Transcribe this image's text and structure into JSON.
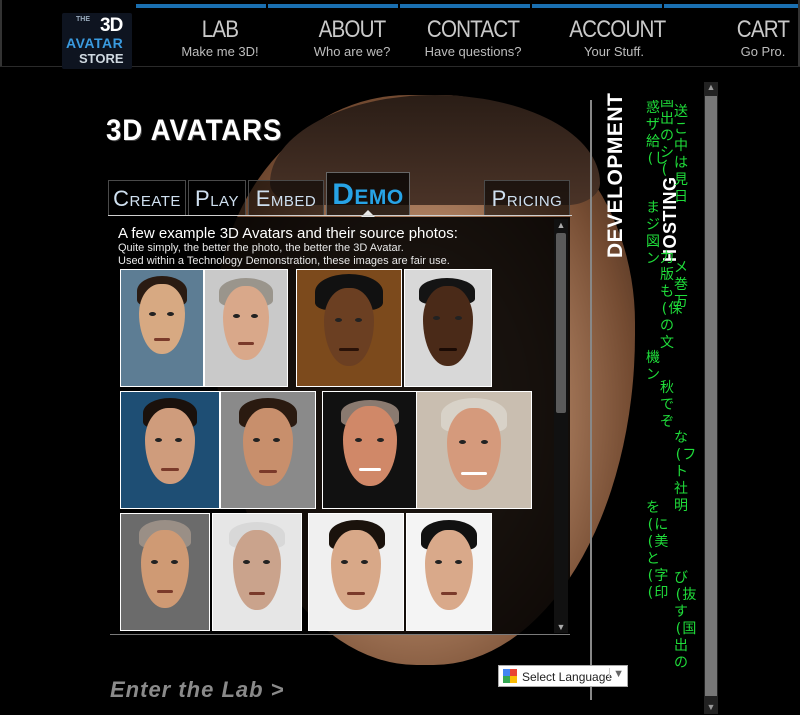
{
  "logo": {
    "the": "THE",
    "three_d": "3D",
    "avatar": "AVATAR",
    "store": "STORE"
  },
  "nav": [
    {
      "title": "LAB",
      "subtitle": "Make me 3D!"
    },
    {
      "title": "ABOUT",
      "subtitle": "Who are we?"
    },
    {
      "title": "CONTACT",
      "subtitle": "Have questions?"
    },
    {
      "title": "ACCOUNT",
      "subtitle": "Your Stuff."
    },
    {
      "title": "CART",
      "subtitle": "Go Pro."
    }
  ],
  "page_title": "3D AVATARS",
  "tabs": [
    {
      "label": "Create"
    },
    {
      "label": "Play"
    },
    {
      "label": "Embed"
    },
    {
      "label": "Demo"
    },
    {
      "label": "Pricing"
    }
  ],
  "intro": {
    "heading": "A few example 3D Avatars and their source photos:",
    "line1": "Quite simply, the better the photo, the better the 3D Avatar.",
    "line2": "Used within a Technology Demonstration, these images are fair use."
  },
  "side": {
    "development": "DEVELOPMENT",
    "hosting": "HOSTING"
  },
  "matrix_columns": [
    "惑ザ給(し",
    "国出のシ(",
    "送こ中は見日",
    "まジ図ン",
    "力版も(保の文",
    "メ巻万",
    "機ン",
    "秋でぞ",
    "な(フト社明",
    "を(に(美と(字(印",
    "び(抜す(国出の"
  ],
  "footer": {
    "enter_lab": "Enter the Lab >",
    "language_select": "Select Language"
  },
  "colors": {
    "accent": "#27a3e6",
    "matrix_green": "#1fdc3a"
  }
}
